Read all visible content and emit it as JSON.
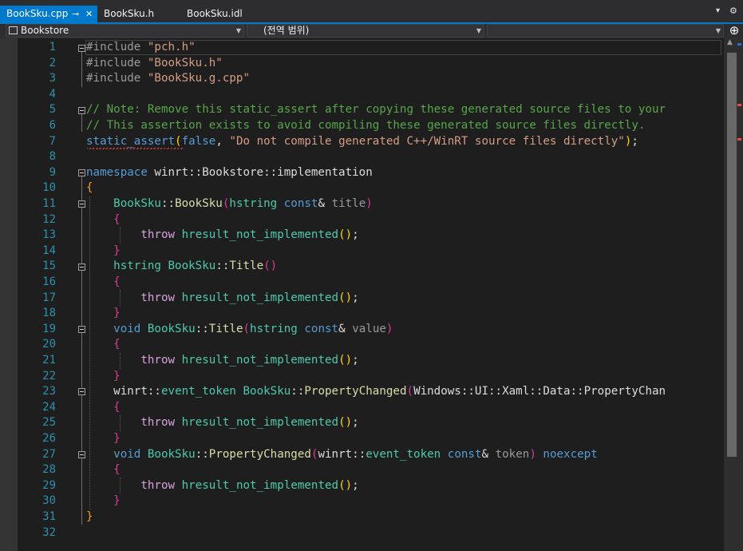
{
  "tabs": [
    {
      "label": "BookSku.cpp",
      "active": true
    },
    {
      "label": "BookSku.h",
      "active": false
    },
    {
      "label": "BookSku.idl",
      "active": false
    }
  ],
  "tab_tools": {
    "dropdown": "▾",
    "settings": "⚙"
  },
  "navbar": {
    "project": "Bookstore",
    "scope": "(전역 범위)",
    "member": ""
  },
  "editor": {
    "line_numbers": [
      "1",
      "2",
      "3",
      "4",
      "5",
      "6",
      "7",
      "8",
      "9",
      "10",
      "11",
      "12",
      "13",
      "14",
      "15",
      "16",
      "17",
      "18",
      "19",
      "20",
      "21",
      "22",
      "23",
      "24",
      "25",
      "26",
      "27",
      "28",
      "29",
      "30",
      "31",
      "32"
    ],
    "lines": {
      "l1": {
        "a": "#include ",
        "b": "\"pch.h\""
      },
      "l2": {
        "a": "#include ",
        "b": "\"BookSku.h\""
      },
      "l3": {
        "a": "#include ",
        "b": "\"BookSku.g.cpp\""
      },
      "l5": "// Note: Remove this static_assert after copying these generated source files to your",
      "l6": "// This assertion exists to avoid compiling these generated source files directly.",
      "l7": {
        "fn": "static_assert",
        "kw": "false",
        "str": "\"Do not compile generated C++/WinRT source files directly\""
      },
      "l9": {
        "kw": "namespace",
        "rest": " winrt::Bookstore::implementation"
      },
      "l11": {
        "t1": "BookSku",
        "f": "BookSku",
        "t2": "hstring",
        "k": "const",
        "p": "title"
      },
      "l15": {
        "t1": "hstring",
        "t2": "BookSku",
        "f": "Title"
      },
      "l19": {
        "k": "void",
        "t": "BookSku",
        "f": "Title",
        "t2": "hstring",
        "k2": "const",
        "p": "value"
      },
      "l23": {
        "ns": "winrt",
        "ty": "event_token",
        "t": "BookSku",
        "f": "PropertyChanged",
        "arg": "Windows::UI::Xaml::Data::PropertyChan"
      },
      "l27": {
        "k": "void",
        "t": "BookSku",
        "f": "PropertyChanged",
        "ns": "winrt",
        "ty": "event_token",
        "k2": "const",
        "p": "token",
        "k3": "noexcept"
      },
      "throw_kw": "throw",
      "throw_fn": "hresult_not_implemented"
    }
  }
}
